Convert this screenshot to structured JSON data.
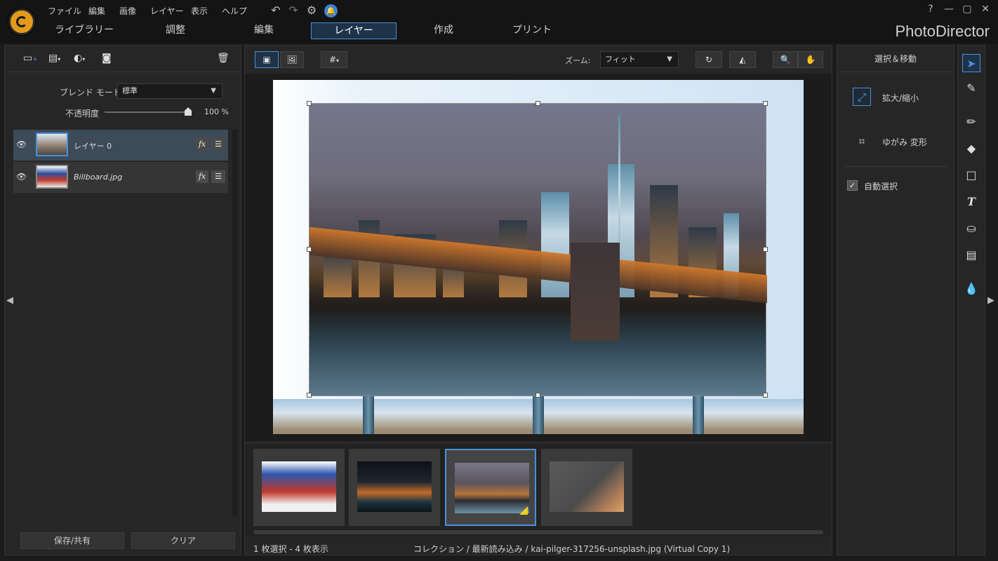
{
  "app": {
    "brand": "PhotoDirector"
  },
  "menu": [
    "ファイル",
    "編集",
    "画像",
    "レイヤー",
    "表示",
    "ヘルプ"
  ],
  "window_controls": [
    "?",
    "—",
    "▢",
    "✕"
  ],
  "tabs": [
    {
      "label": "ライブラリー",
      "active": false
    },
    {
      "label": "調整",
      "active": false
    },
    {
      "label": "編集",
      "active": false
    },
    {
      "label": "レイヤー",
      "active": true
    },
    {
      "label": "作成",
      "active": false
    },
    {
      "label": "プリント",
      "active": false
    }
  ],
  "left_panel": {
    "blend_mode_label": "ブレンド モード:",
    "blend_mode_value": "標準",
    "opacity_label": "不透明度",
    "opacity_value": "100 %",
    "opacity_fraction": 1.0,
    "layers": [
      {
        "name": "レイヤー 0",
        "selected": true,
        "fx": "fx",
        "adj": "☰"
      },
      {
        "name": "Billboard.jpg",
        "selected": false,
        "fx": "fx",
        "adj": "☰"
      }
    ],
    "save_share_button": "保存/共有",
    "clear_button": "クリア"
  },
  "center": {
    "zoom_label": "ズーム:",
    "zoom_value": "フィット",
    "status_selection": "1 枚選択 - 4 枚表示",
    "status_path": "コレクション / 最新読み込み / kai-pilger-317256-unsplash.jpg (Virtual Copy 1)"
  },
  "right_panel": {
    "header": "選択＆移動",
    "resize_label": "拡大/縮小",
    "distort_label": "ゆがみ 変形",
    "auto_select_label": "自動選択",
    "auto_select_checked": true
  },
  "colors": {
    "accent": "#4a90d9",
    "background": "#1b1b1b",
    "panel": "#262626",
    "logo": "#e39a1a"
  },
  "icons": {
    "tools": [
      "pointer-icon",
      "clone-brush-icon",
      "pen-icon",
      "eraser-icon",
      "rectangle-icon",
      "text-icon",
      "fill-bucket-icon",
      "gradient-icon",
      "drop-icon"
    ]
  }
}
